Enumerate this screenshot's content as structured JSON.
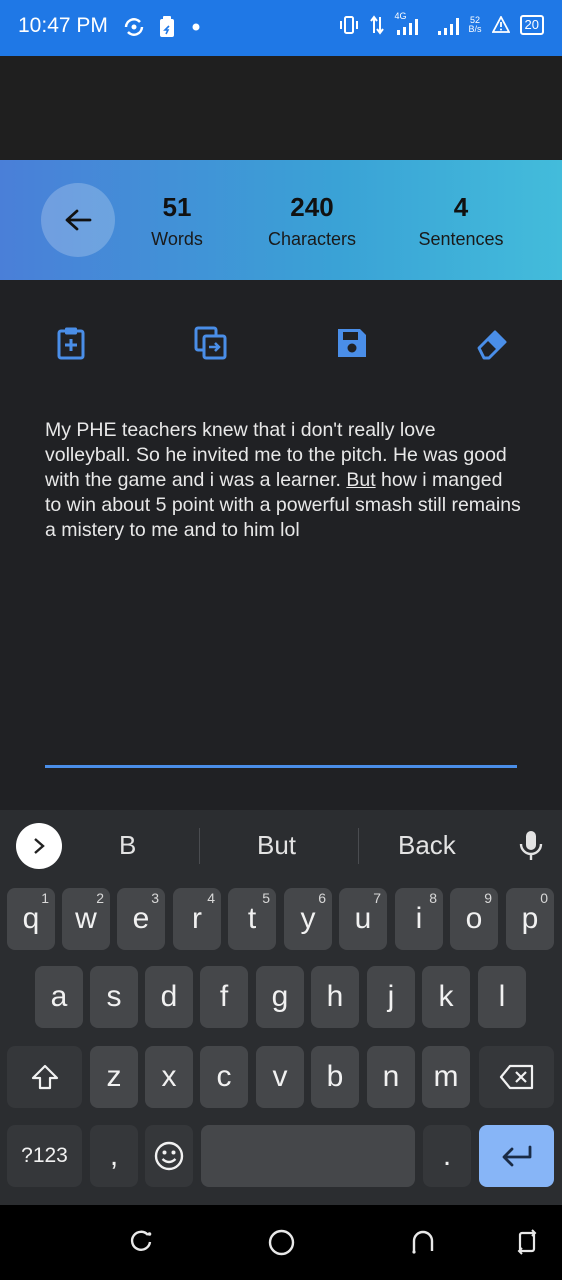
{
  "status_bar": {
    "time": "10:47 PM",
    "network": "4G",
    "speed_value": "52",
    "speed_unit": "B/s",
    "battery": "20",
    "icons": [
      "sync-icon",
      "clipboard-icon",
      "dot-icon",
      "vibrate-icon",
      "data-arrows-icon",
      "signal-icon",
      "signal-icon-2",
      "warning-icon",
      "battery-icon"
    ]
  },
  "stats": {
    "words_count": "51",
    "words_label": "Words",
    "characters_count": "240",
    "characters_label": "Characters",
    "sentences_count": "4",
    "sentences_label": "Sentences"
  },
  "toolbar": {
    "icons": [
      "paste-icon",
      "copy-icon",
      "save-icon",
      "eraser-icon"
    ],
    "accent": "#4a8ee8"
  },
  "editor": {
    "text_before": "My PHE teachers knew that i don't really love volleyball. So he invited me to the pitch. He was good with the game and i was a learner. ",
    "text_underlined": "But",
    "text_after": " how i manged to win about 5 point with a powerful smash still remains a mistery to me and to him lol"
  },
  "keyboard": {
    "suggestions": [
      "B",
      "But",
      "Back"
    ],
    "row1": [
      {
        "key": "q",
        "hint": "1"
      },
      {
        "key": "w",
        "hint": "2"
      },
      {
        "key": "e",
        "hint": "3"
      },
      {
        "key": "r",
        "hint": "4"
      },
      {
        "key": "t",
        "hint": "5"
      },
      {
        "key": "y",
        "hint": "6"
      },
      {
        "key": "u",
        "hint": "7"
      },
      {
        "key": "i",
        "hint": "8"
      },
      {
        "key": "o",
        "hint": "9"
      },
      {
        "key": "p",
        "hint": "0"
      }
    ],
    "row2": [
      "a",
      "s",
      "d",
      "f",
      "g",
      "h",
      "j",
      "k",
      "l"
    ],
    "row3": [
      "z",
      "x",
      "c",
      "v",
      "b",
      "n",
      "m"
    ],
    "symbols_label": "?123",
    "comma": ",",
    "period": "."
  },
  "colors": {
    "status_bar": "#1f78e6",
    "gradient_start": "#4a7fd8",
    "gradient_end": "#43bcdb",
    "enter_key": "#87b5f7"
  }
}
